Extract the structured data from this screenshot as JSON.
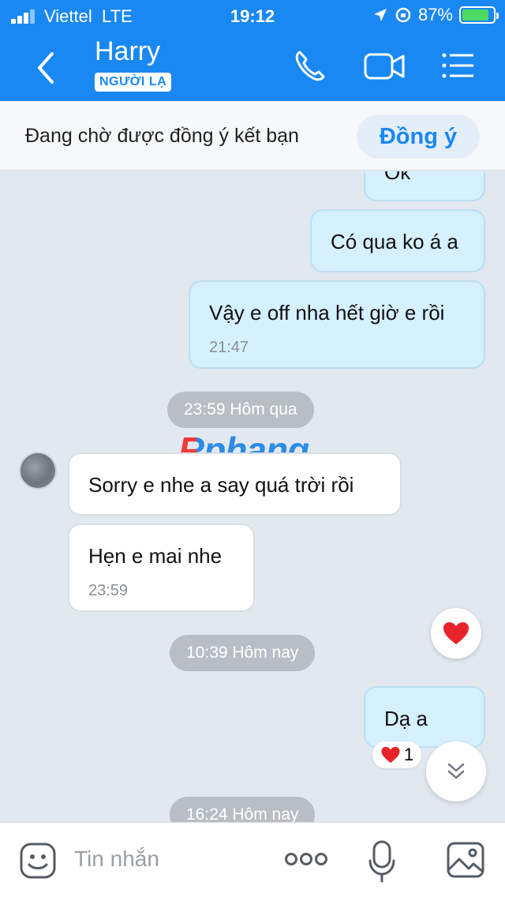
{
  "status_bar": {
    "carrier": "Viettel",
    "network": "LTE",
    "time": "19:12",
    "battery": "87%",
    "battery_level": 0.87
  },
  "header": {
    "contact_name": "Harry",
    "stranger_badge": "NGƯỜI LẠ",
    "icons": [
      "back-icon",
      "phone-icon",
      "video-call-icon",
      "menu-icon"
    ]
  },
  "friend_request": {
    "text": "Đang chờ được đồng ý kết bạn",
    "accept_label": "Đồng ý"
  },
  "messages": [
    {
      "direction": "out",
      "text": "Ok"
    },
    {
      "direction": "out",
      "text": "Có qua ko á a"
    },
    {
      "direction": "out",
      "text": "Vậy e off nha hết giờ e rồi",
      "time": "21:47"
    },
    {
      "type": "time_divider",
      "text": "23:59 Hôm qua"
    },
    {
      "direction": "in",
      "text": "Sorry e nhe a say quá trời rồi"
    },
    {
      "direction": "in",
      "text": "Hẹn e mai nhe",
      "time": "23:59"
    },
    {
      "type": "time_divider",
      "text": "10:39 Hôm nay"
    },
    {
      "direction": "out",
      "text": "Dạ a",
      "reaction_count": "1"
    },
    {
      "type": "time_divider",
      "text": "16:24 Hôm nay"
    }
  ],
  "watermark": "Rphang",
  "input_bar": {
    "placeholder": "Tin nhắn",
    "icons": [
      "sticker-icon",
      "more-icon",
      "microphone-icon",
      "image-icon"
    ]
  },
  "colors": {
    "header_blue": "#1a88f3",
    "outgoing_bubble": "#d5f0ff",
    "incoming_bubble": "#ffffff",
    "chat_background": "#e2e8f0"
  }
}
